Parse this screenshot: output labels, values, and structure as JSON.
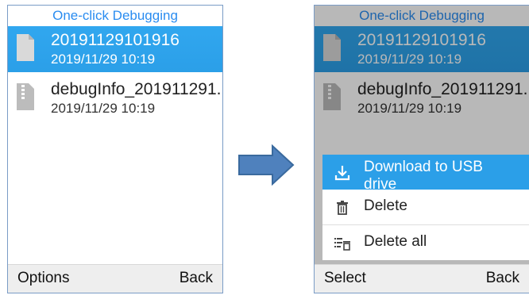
{
  "screen_left": {
    "title": "One-click Debugging",
    "files": [
      {
        "name": "20191129101916",
        "date": "2019/11/29  10:19",
        "selected": true,
        "icon": "document-icon"
      },
      {
        "name": "debugInfo_201911291..",
        "date": "2019/11/29  10:19",
        "selected": false,
        "icon": "zip-file-icon"
      }
    ],
    "softkeys": {
      "left": "Options",
      "right": "Back"
    }
  },
  "screen_right": {
    "title": "One-click Debugging",
    "files": [
      {
        "name": "20191129101916",
        "date": "2019/11/29  10:19",
        "icon": "document-icon"
      },
      {
        "name": "debugInfo_201911291..",
        "date": "2019/11/29  10:19",
        "icon": "zip-file-icon"
      }
    ],
    "menu": [
      {
        "label": "Download to USB drive",
        "icon": "download-icon",
        "active": true
      },
      {
        "label": "Delete",
        "icon": "trash-icon",
        "active": false
      },
      {
        "label": "Delete all",
        "icon": "delete-all-icon",
        "active": false
      }
    ],
    "softkeys": {
      "left": "Select",
      "right": "Back"
    }
  },
  "colors": {
    "accent": "#2b9fe8",
    "title": "#2a8cf0",
    "arrow": "#4f81bd"
  }
}
